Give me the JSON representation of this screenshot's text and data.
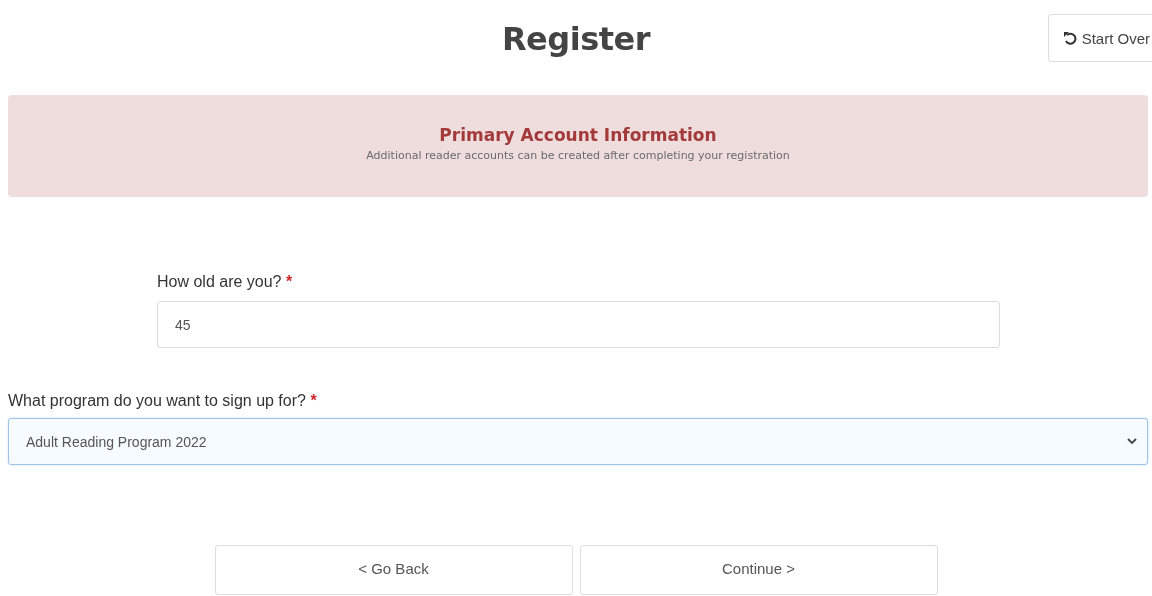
{
  "title": "Register",
  "start_over": {
    "label": "Start Over"
  },
  "banner": {
    "heading": "Primary Account Information",
    "text": "Additional reader accounts can be created after completing your registration"
  },
  "fields": [
    {
      "kind": "input",
      "label": "How old are you?",
      "required_mark": "*",
      "value": "45",
      "wide": false,
      "focused": false
    },
    {
      "kind": "select",
      "label": "What program do you want to sign up for?",
      "required_mark": "*",
      "value": "Adult Reading Program 2022",
      "wide": true,
      "focused": true
    }
  ],
  "buttons": [
    {
      "label": "< Go Back"
    },
    {
      "label": "Continue >"
    }
  ]
}
